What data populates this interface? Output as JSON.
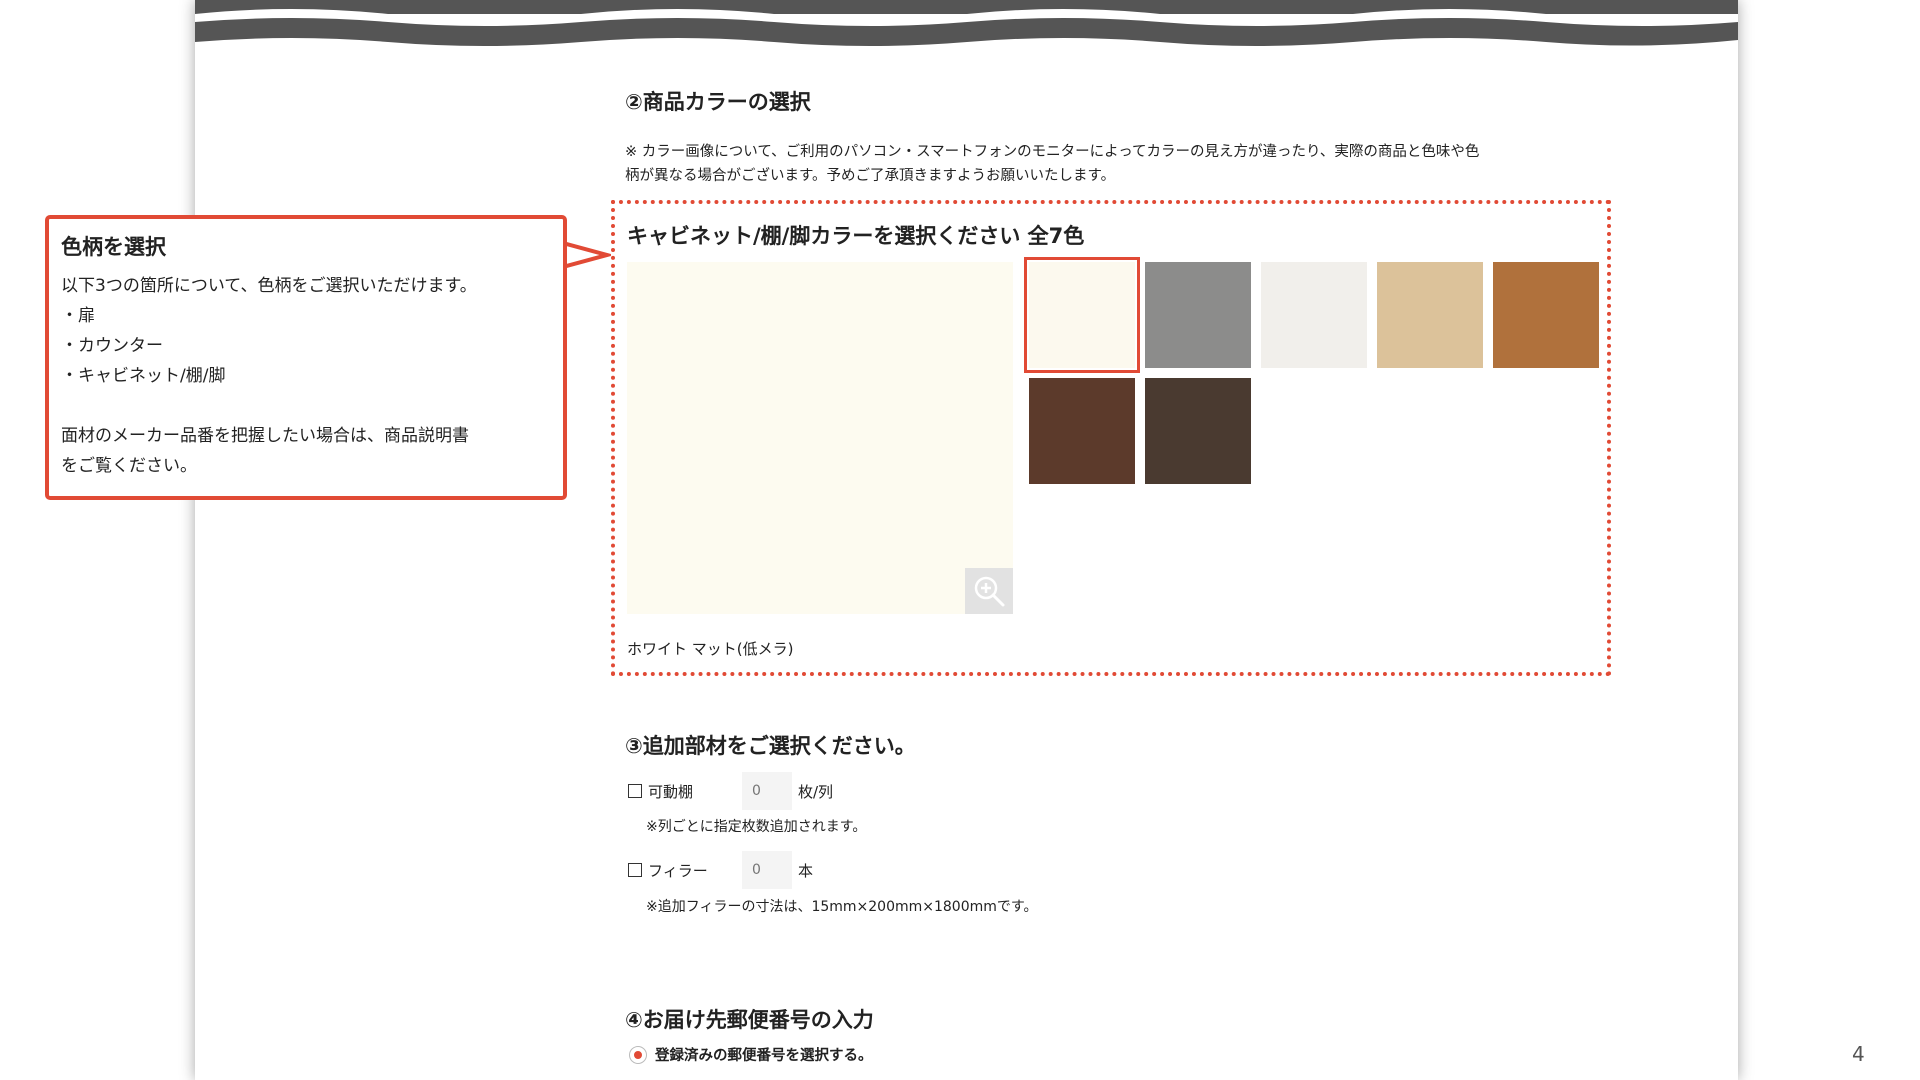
{
  "section2": {
    "title": "②商品カラーの選択",
    "note_line1": "※ カラー画像について、ご利用のパソコン・スマートフォンのモニターによってカラーの見え方が違ったり、実際の商品と色味や色",
    "note_line2": "柄が異なる場合がございます。予めご了承頂きますようお願いいたします。"
  },
  "color_select": {
    "title": "キャビネット/棚/脚カラーを選択ください 全7色",
    "selected_name": "ホワイト マット(低メラ)",
    "zoom_icon": "zoom-in-icon",
    "swatches": [
      {
        "color": "#fcf9ee",
        "selected": true
      },
      {
        "color": "#8c8c8b",
        "selected": false
      },
      {
        "color": "#f1efeb",
        "selected": false
      },
      {
        "color": "#dcc29a",
        "selected": false
      },
      {
        "color": "#b0713c",
        "selected": false
      },
      {
        "color": "#5c3a2b",
        "selected": false
      },
      {
        "color": "#4a3a30",
        "selected": false
      }
    ]
  },
  "section3": {
    "title": "③追加部材をご選択ください。",
    "shelf": {
      "label": "可動棚",
      "placeholder": "0",
      "unit": "枚/列",
      "note": "※列ごとに指定枚数追加されます。"
    },
    "filler": {
      "label": "フィラー",
      "placeholder": "0",
      "unit": "本",
      "note": "※追加フィラーの寸法は、15mm×200mm×1800mmです。"
    }
  },
  "section4": {
    "title": "④お届け先郵便番号の入力",
    "radio_label": "登録済みの郵便番号を選択する。"
  },
  "callout": {
    "title": "色柄を選択",
    "lines": [
      "以下3つの箇所について、色柄をご選択いただけます。",
      "・扉",
      "・カウンター",
      "・キャビネット/棚/脚",
      "",
      "面材のメーカー品番を把握したい場合は、商品説明書",
      "をご覧ください。"
    ]
  },
  "page_number": "4",
  "colors": {
    "accent": "#e14a35",
    "wave": "#555555"
  }
}
